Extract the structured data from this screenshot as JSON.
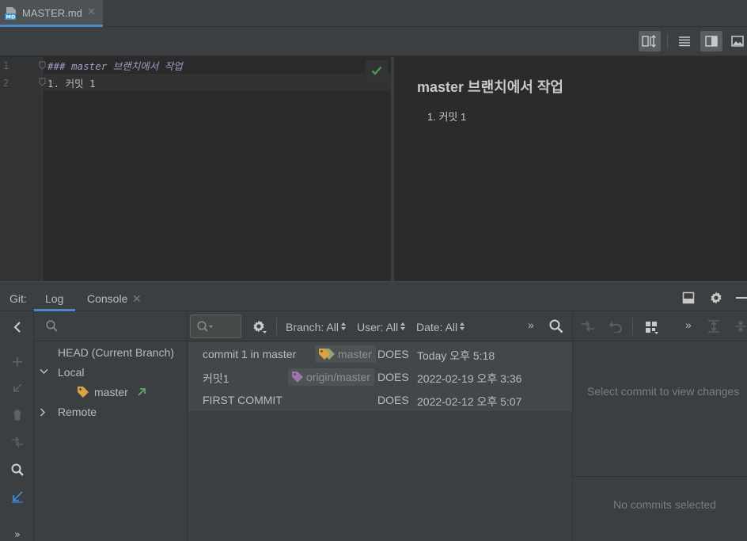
{
  "editor_tab": {
    "file_name": "MASTER.md",
    "close_glyph": "✕",
    "icon": "markdown-file-icon"
  },
  "toolbar": {
    "buttons": [
      "editor-and-preview-sync-icon",
      "editor-only-icon",
      "split-view-icon",
      "preview-only-icon"
    ]
  },
  "editor": {
    "line_numbers": [
      "1",
      "2"
    ],
    "lines": [
      "### master 브랜치에서 작업",
      "1. 커밋 1"
    ]
  },
  "preview": {
    "heading": "master 브랜치에서 작업",
    "list_item": "1. 커밋 1"
  },
  "git_panel": {
    "label": "Git:",
    "tabs": [
      {
        "label": "Log",
        "active": true
      },
      {
        "label": "Console",
        "active": false,
        "close_glyph": "✕"
      }
    ]
  },
  "branches": {
    "items": {
      "head": "HEAD (Current Branch)",
      "local": "Local",
      "master": "master",
      "remote": "Remote"
    }
  },
  "log_filters": {
    "branch": "Branch: All",
    "user": "User: All",
    "date": "Date: All",
    "more": "»"
  },
  "commits": [
    {
      "message": "commit 1 in master",
      "ref": "master",
      "author": "DOES",
      "date": "Today 오후 5:18"
    },
    {
      "message": "커밋1",
      "ref": "origin/master",
      "author": "DOES",
      "date": "2022-02-19 오후 3:36"
    },
    {
      "message": "FIRST COMMIT",
      "ref": "",
      "author": "DOES",
      "date": "2022-02-12 오후 5:07"
    }
  ],
  "details": {
    "hint": "Select commit to view changes",
    "empty": "No commits selected",
    "more": "»"
  },
  "left_strip": {
    "more": "»"
  },
  "colors": {
    "accent_blue": "#4a88c7",
    "graph_green": "#8fa876",
    "check_green": "#499c54",
    "tag_yellow": "#d9a343",
    "tag_purple": "#9876aa"
  }
}
